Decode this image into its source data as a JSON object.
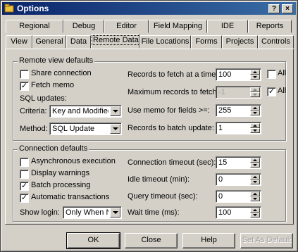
{
  "window": {
    "title": "Options",
    "help_btn": "?",
    "close_btn": "×"
  },
  "tabs_row1": [
    "Regional",
    "Debug",
    "Editor",
    "Field Mapping",
    "IDE",
    "Reports"
  ],
  "tabs_row2": [
    "View",
    "General",
    "Data",
    "Remote Data",
    "File Locations",
    "Forms",
    "Projects",
    "Controls"
  ],
  "remote_view": {
    "legend": "Remote view defaults",
    "share_connection": {
      "label": "Share connection",
      "checked": false
    },
    "fetch_memo": {
      "label": "Fetch memo",
      "checked": true
    },
    "sql_updates_label": "SQL updates:",
    "criteria_label": "Criteria:",
    "criteria_value": "Key and Modified F",
    "method_label": "Method:",
    "method_value": "SQL Update",
    "records_fetch_label": "Records to fetch at a time:",
    "records_fetch_value": "100",
    "records_fetch_all": {
      "label": "All",
      "checked": false
    },
    "max_records_label": "Maximum records to fetch:",
    "max_records_value": "-1",
    "max_records_all": {
      "label": "All",
      "checked": true
    },
    "memo_fields_label": "Use memo for fields >=:",
    "memo_fields_value": "255",
    "batch_update_label": "Records to batch update:",
    "batch_update_value": "1"
  },
  "connection": {
    "legend": "Connection defaults",
    "async": {
      "label": "Asynchronous execution",
      "checked": false
    },
    "warnings": {
      "label": "Display warnings",
      "checked": false
    },
    "batch": {
      "label": "Batch processing",
      "checked": true
    },
    "auto_trans": {
      "label": "Automatic transactions",
      "checked": true
    },
    "show_login_label": "Show login:",
    "show_login_value": "Only When N",
    "conn_timeout_label": "Connection timeout (sec):",
    "conn_timeout_value": "15",
    "idle_timeout_label": "Idle timeout (min):",
    "idle_timeout_value": "0",
    "query_timeout_label": "Query timeout (sec):",
    "query_timeout_value": "0",
    "wait_time_label": "Wait time (ms):",
    "wait_time_value": "100"
  },
  "buttons": {
    "ok": "OK",
    "close": "Close",
    "help": "Help",
    "set_default": "Set As Default"
  }
}
